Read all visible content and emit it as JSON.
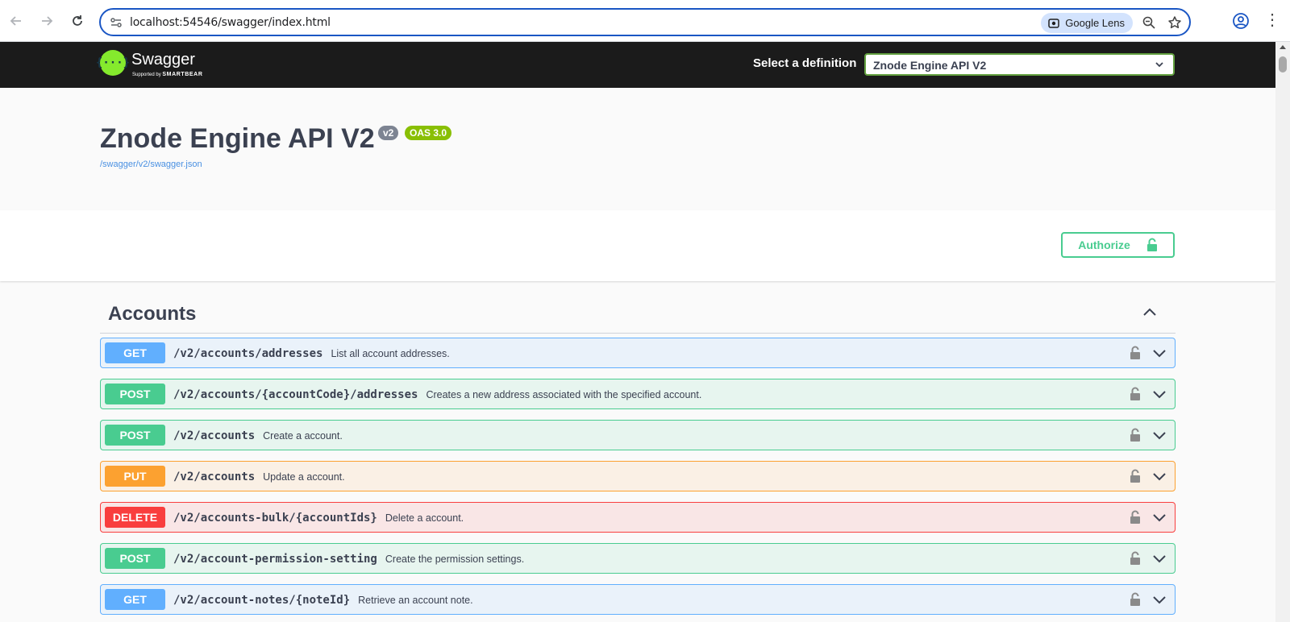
{
  "browser": {
    "url": "localhost:54546/swagger/index.html",
    "lens_label": "Google Lens"
  },
  "topbar": {
    "logo_name": "Swagger",
    "logo_sub_prefix": "Supported by",
    "logo_sub_brand": "SMARTBEAR",
    "select_label": "Select a definition",
    "selected_definition": "Znode Engine API V2"
  },
  "info": {
    "title": "Znode Engine API V2",
    "version_badge": "v2",
    "oas_badge": "OAS 3.0",
    "spec_url": "/swagger/v2/swagger.json"
  },
  "authorize_label": "Authorize",
  "tag": {
    "name": "Accounts",
    "operations": [
      {
        "method": "GET",
        "path": "/v2/accounts/addresses",
        "summary": "List all account addresses."
      },
      {
        "method": "POST",
        "path": "/v2/accounts/{accountCode}/addresses",
        "summary": "Creates a new address associated with the specified account."
      },
      {
        "method": "POST",
        "path": "/v2/accounts",
        "summary": "Create a account."
      },
      {
        "method": "PUT",
        "path": "/v2/accounts",
        "summary": "Update a account."
      },
      {
        "method": "DELETE",
        "path": "/v2/accounts-bulk/{accountIds}",
        "summary": "Delete a account."
      },
      {
        "method": "POST",
        "path": "/v2/account-permission-setting",
        "summary": "Create the permission settings."
      },
      {
        "method": "GET",
        "path": "/v2/account-notes/{noteId}",
        "summary": "Retrieve an account note."
      }
    ]
  },
  "colors": {
    "get": "#61affe",
    "post": "#49cc90",
    "put": "#fca130",
    "delete": "#f93e3e",
    "topbar_bg": "#1b1b1b",
    "logo_green": "#85ea2d"
  },
  "icons": [
    "back-arrow-icon",
    "forward-arrow-icon",
    "reload-icon",
    "site-info-icon",
    "camera-lens-icon",
    "zoom-icon",
    "star-icon",
    "profile-icon",
    "kebab-menu-icon",
    "chevron-down-icon",
    "chevron-up-icon",
    "lock-icon",
    "unlocked-padlock-icon"
  ]
}
